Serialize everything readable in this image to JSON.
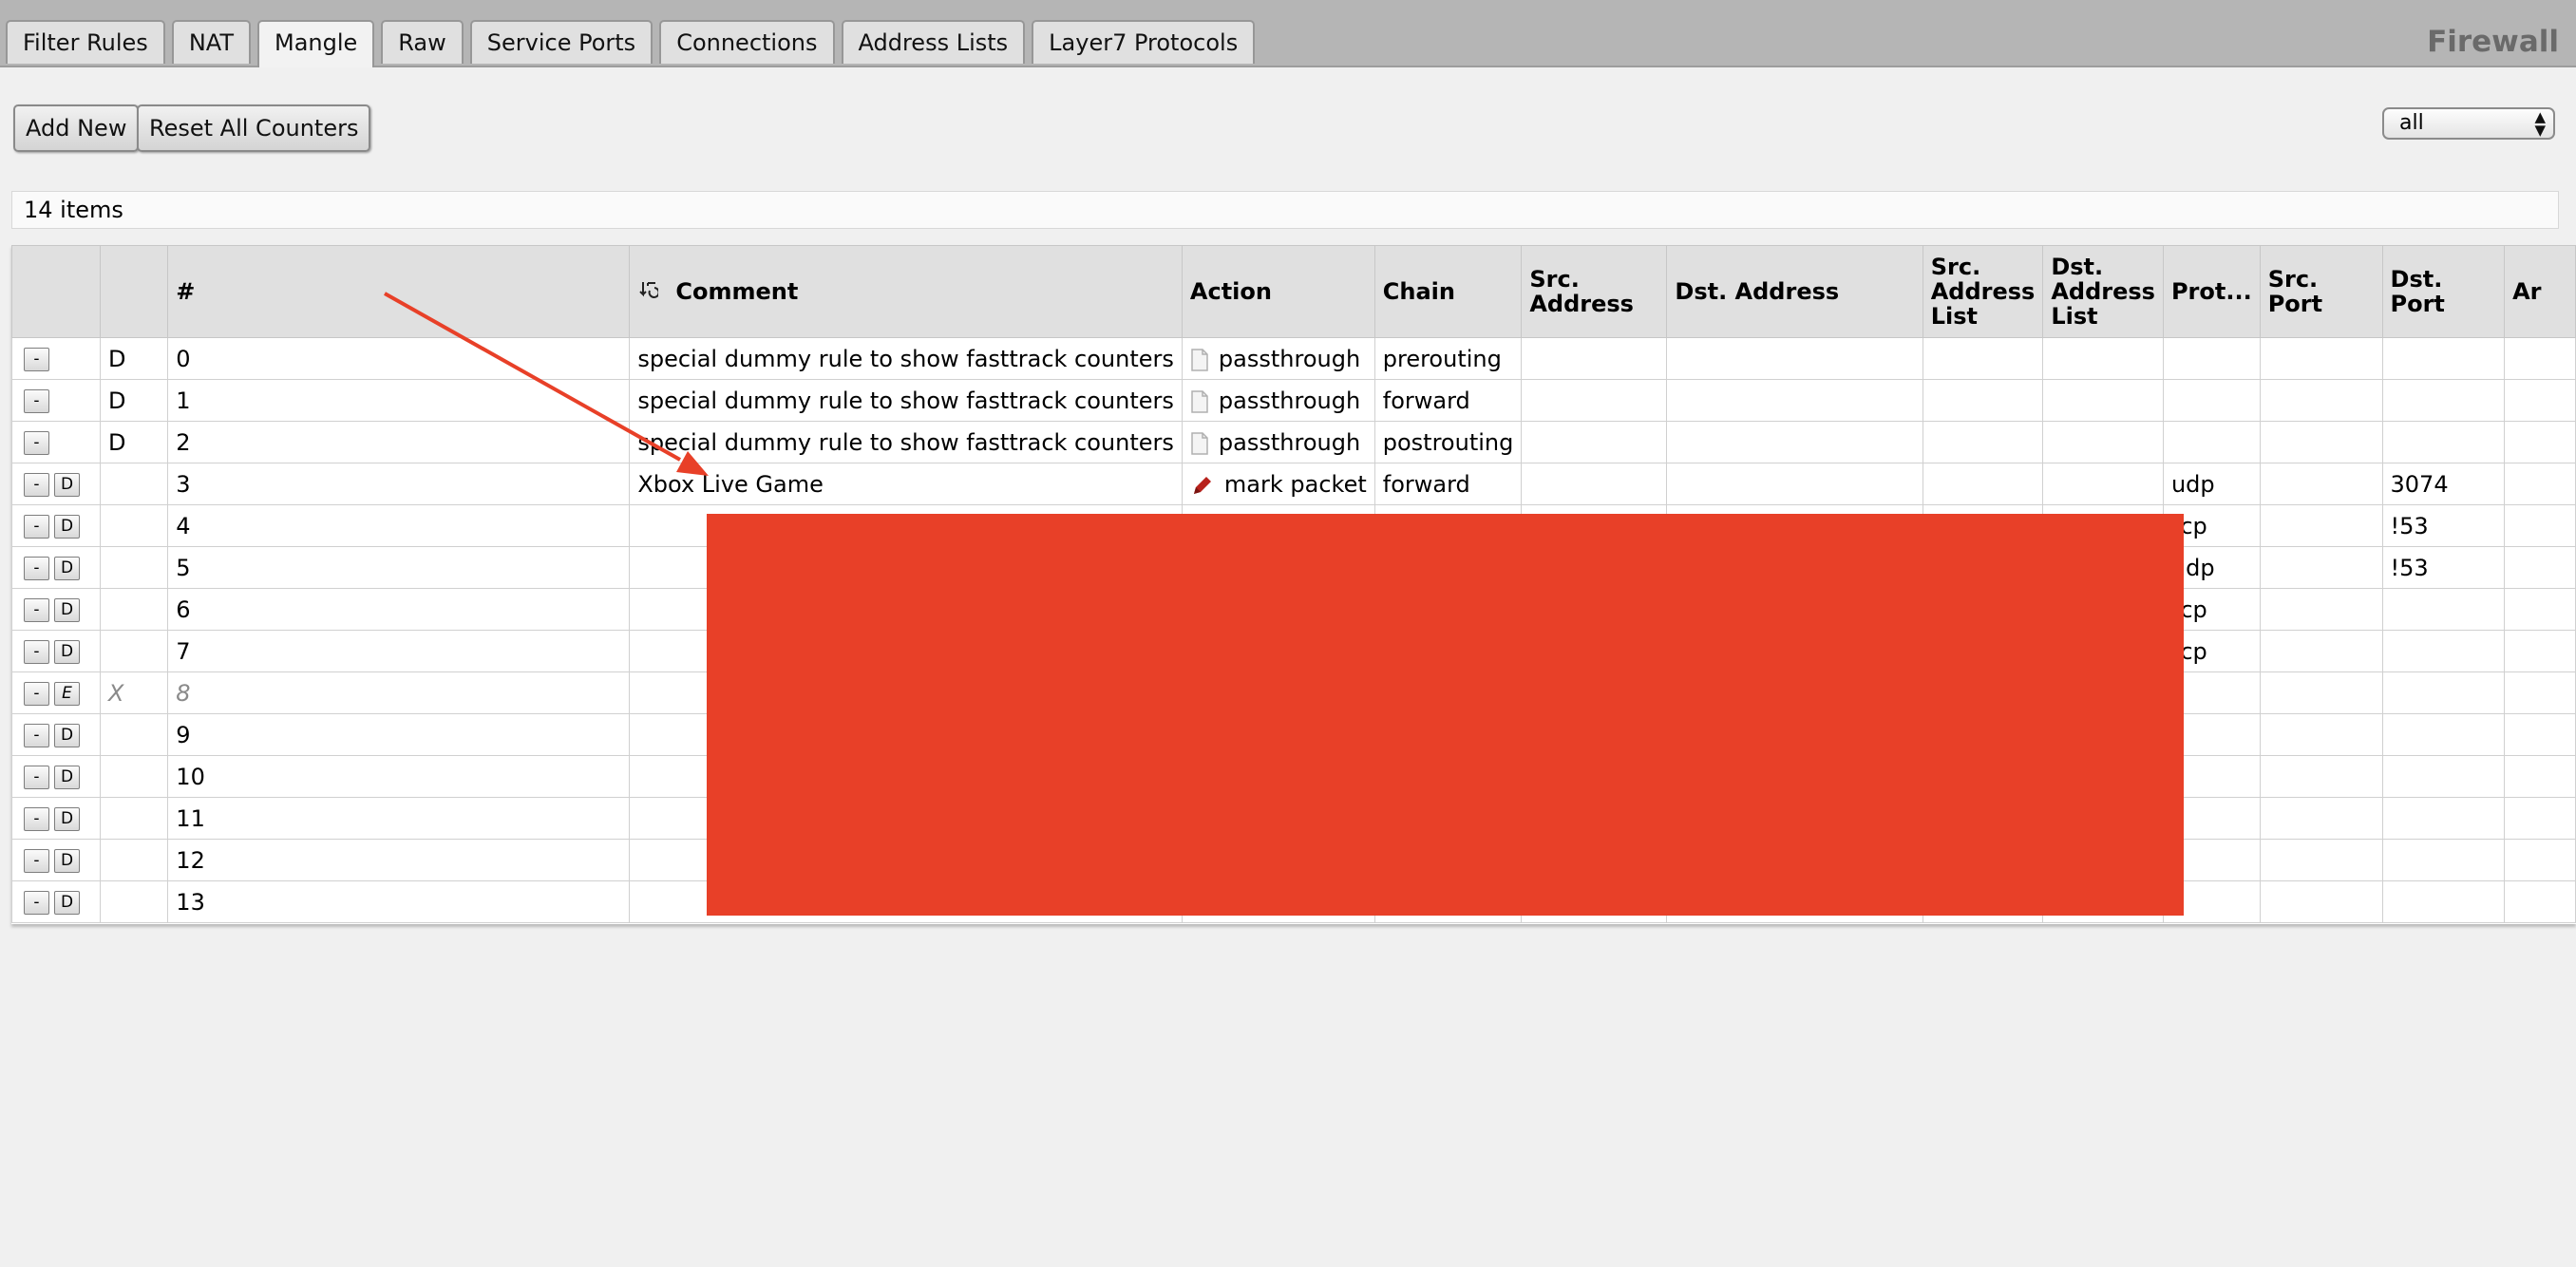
{
  "app": {
    "title": "Firewall"
  },
  "tabs": [
    {
      "label": "Filter Rules",
      "active": false
    },
    {
      "label": "NAT",
      "active": false
    },
    {
      "label": "Mangle",
      "active": true
    },
    {
      "label": "Raw",
      "active": false
    },
    {
      "label": "Service Ports",
      "active": false
    },
    {
      "label": "Connections",
      "active": false
    },
    {
      "label": "Address Lists",
      "active": false
    },
    {
      "label": "Layer7 Protocols",
      "active": false
    }
  ],
  "toolbar": {
    "add_new_label": "Add New",
    "reset_counters_label": "Reset All Counters"
  },
  "filter": {
    "selected": "all"
  },
  "list": {
    "count_label": "14 items"
  },
  "table": {
    "headers": {
      "num": "#",
      "comment": "Comment",
      "action": "Action",
      "chain": "Chain",
      "src_address": "Src. Address",
      "dst_address": "Dst. Address",
      "src_address_list": "Src. Address List",
      "dst_address_list": "Dst. Address List",
      "protocol": "Prot...",
      "src_port": "Src. Port",
      "dst_port": "Dst. Port",
      "next": "Ar"
    },
    "rows": [
      {
        "btn1": "-",
        "btn2": "",
        "flag": "D",
        "num": "0",
        "comment": "special dummy rule to show fasttrack counters",
        "action_icon": "document-icon",
        "action": "passthrough",
        "chain": "prerouting",
        "src_address": "",
        "dst_address": "",
        "src_list": "",
        "dst_list": "",
        "protocol": "",
        "src_port": "",
        "dst_port": ""
      },
      {
        "btn1": "-",
        "btn2": "",
        "flag": "D",
        "num": "1",
        "comment": "special dummy rule to show fasttrack counters",
        "action_icon": "document-icon",
        "action": "passthrough",
        "chain": "forward",
        "src_address": "",
        "dst_address": "",
        "src_list": "",
        "dst_list": "",
        "protocol": "",
        "src_port": "",
        "dst_port": ""
      },
      {
        "btn1": "-",
        "btn2": "",
        "flag": "D",
        "num": "2",
        "comment": "special dummy rule to show fasttrack counters",
        "action_icon": "document-icon",
        "action": "passthrough",
        "chain": "postrouting",
        "src_address": "",
        "dst_address": "",
        "src_list": "",
        "dst_list": "",
        "protocol": "",
        "src_port": "",
        "dst_port": ""
      },
      {
        "btn1": "-",
        "btn2": "D",
        "flag": "",
        "num": "3",
        "comment": "Xbox Live Game",
        "action_icon": "pencil-icon",
        "action": "mark packet",
        "chain": "forward",
        "src_address": "",
        "dst_address": "",
        "src_list": "",
        "dst_list": "",
        "protocol": "udp",
        "src_port": "",
        "dst_port": "3074"
      },
      {
        "btn1": "-",
        "btn2": "D",
        "flag": "",
        "num": "4",
        "comment": "",
        "action_icon": "",
        "action": "",
        "chain": "",
        "src_address": "",
        "dst_address": "",
        "src_list": "",
        "dst_list": "",
        "protocol": "tcp",
        "src_port": "",
        "dst_port": "!53"
      },
      {
        "btn1": "-",
        "btn2": "D",
        "flag": "",
        "num": "5",
        "comment": "",
        "action_icon": "",
        "action": "",
        "chain": "",
        "src_address": "",
        "dst_address": "",
        "src_list": "",
        "dst_list": "",
        "protocol": "udp",
        "src_port": "",
        "dst_port": "!53"
      },
      {
        "btn1": "-",
        "btn2": "D",
        "flag": "",
        "num": "6",
        "comment": "",
        "action_icon": "",
        "action": "",
        "chain": "",
        "src_address": "",
        "dst_address": "",
        "src_list": "",
        "dst_list": "",
        "protocol": "tcp",
        "src_port": "",
        "dst_port": ""
      },
      {
        "btn1": "-",
        "btn2": "D",
        "flag": "",
        "num": "7",
        "comment": "",
        "action_icon": "",
        "action": "",
        "chain": "",
        "src_address": "",
        "dst_address": "",
        "src_list": "",
        "dst_list": "",
        "protocol": "tcp",
        "src_port": "",
        "dst_port": ""
      },
      {
        "btn1": "-",
        "btn2": "E",
        "flag": "X",
        "num": "8",
        "disabled": true,
        "comment": "",
        "action_icon": "",
        "action": "",
        "chain": "",
        "src_address": "",
        "dst_address": "",
        "src_list": "",
        "dst_list": "",
        "protocol": "",
        "src_port": "",
        "dst_port": ""
      },
      {
        "btn1": "-",
        "btn2": "D",
        "flag": "",
        "num": "9",
        "comment": "",
        "action_icon": "",
        "action": "",
        "chain": "",
        "src_address": "",
        "dst_address": "",
        "src_list": "",
        "dst_list": "",
        "protocol": "",
        "src_port": "",
        "dst_port": ""
      },
      {
        "btn1": "-",
        "btn2": "D",
        "flag": "",
        "num": "10",
        "comment": "",
        "action_icon": "",
        "action": "",
        "chain": "",
        "src_address": "",
        "dst_address": "",
        "src_list": "",
        "dst_list": "",
        "protocol": "",
        "src_port": "",
        "dst_port": ""
      },
      {
        "btn1": "-",
        "btn2": "D",
        "flag": "",
        "num": "11",
        "comment": "",
        "action_icon": "",
        "action": "",
        "chain": "",
        "src_address": "",
        "dst_address": "",
        "src_list": "",
        "dst_list": "",
        "protocol": "",
        "src_port": "",
        "dst_port": ""
      },
      {
        "btn1": "-",
        "btn2": "D",
        "flag": "",
        "num": "12",
        "comment": "",
        "action_icon": "",
        "action": "",
        "chain": "",
        "src_address": "",
        "dst_address": "",
        "src_list": "",
        "dst_list": "",
        "protocol": "",
        "src_port": "",
        "dst_port": ""
      },
      {
        "btn1": "-",
        "btn2": "D",
        "flag": "",
        "num": "13",
        "comment": "",
        "action_icon": "",
        "action": "",
        "chain": "",
        "src_address": "",
        "dst_address": "",
        "src_list": "",
        "dst_list": "",
        "protocol": "",
        "src_port": "",
        "dst_port": ""
      }
    ]
  },
  "colors": {
    "redaction": "#e84028",
    "annotation_arrow": "#e84028"
  }
}
